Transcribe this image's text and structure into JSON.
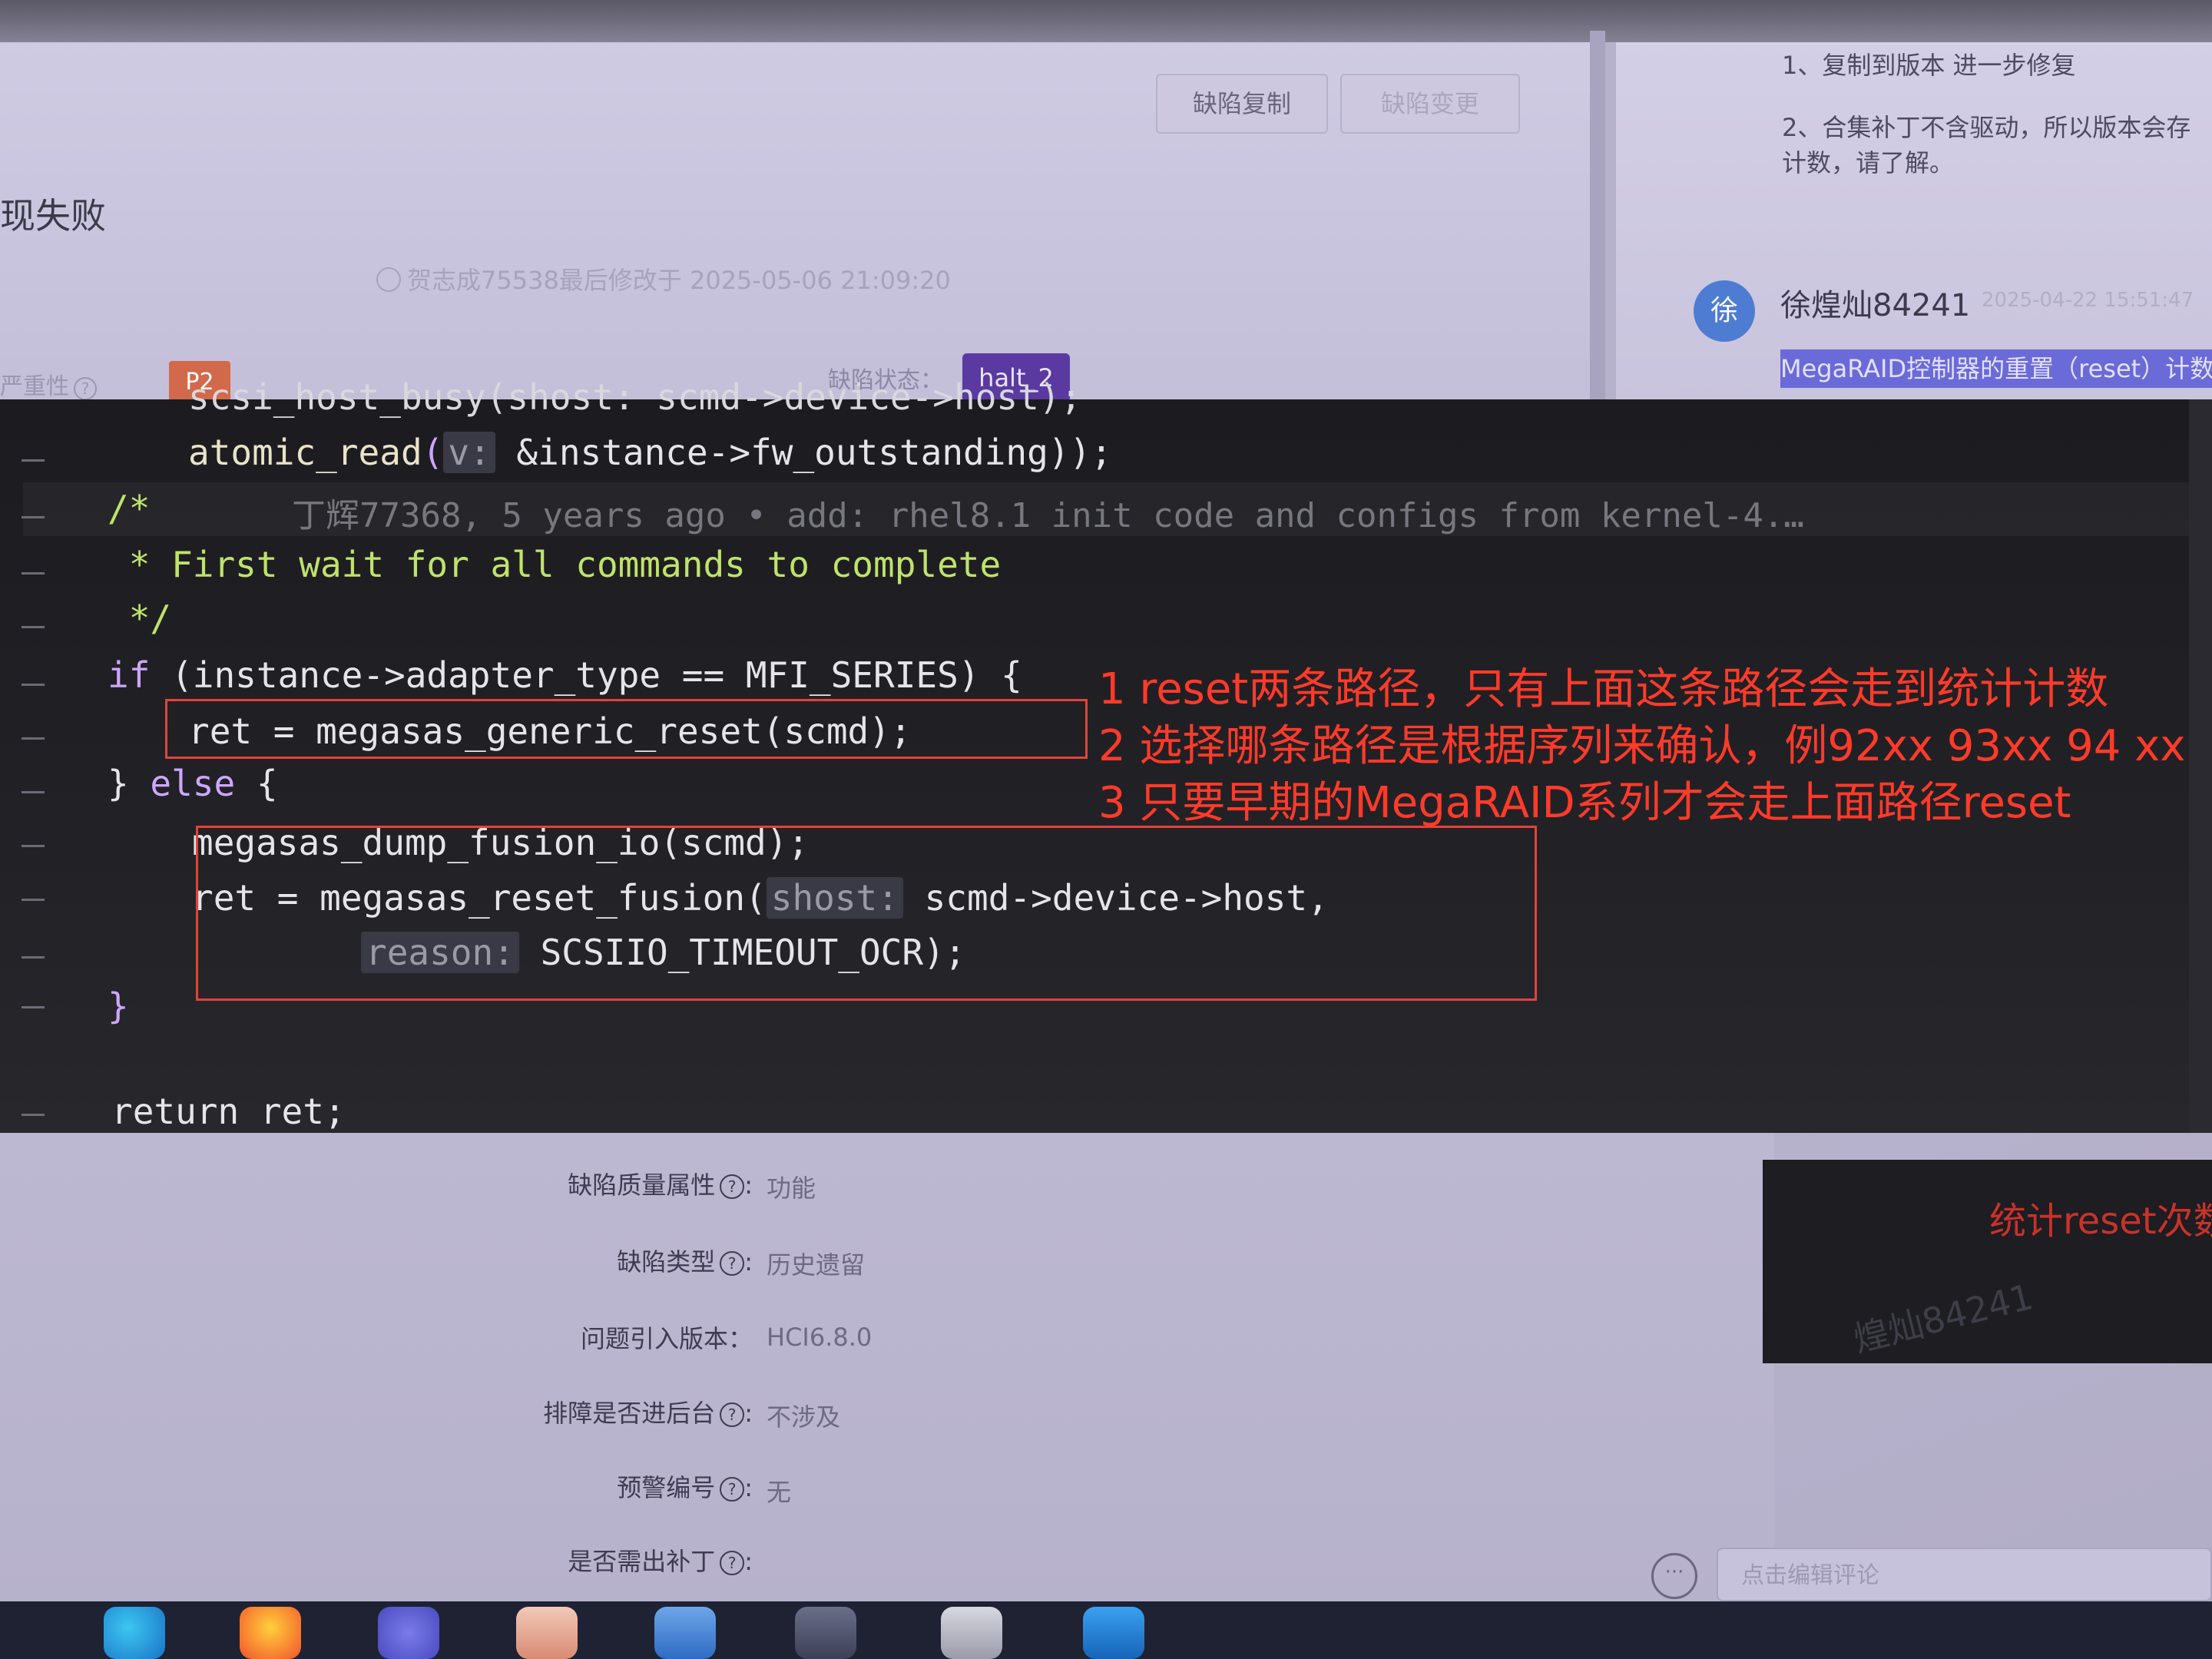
{
  "header": {
    "title_fragment": "现失败",
    "buttons": {
      "copy": "缺陷复制",
      "change": "缺陷变更"
    },
    "modified_info": "贺志成75538最后修改于 2025-05-06 21:09:20",
    "severity_label": "严重性",
    "severity_value": "P2",
    "state_label": "缺陷状态：",
    "state_value": "halt_2"
  },
  "comments": {
    "line1": "1、复制到版本 进一步修复",
    "line2": "2、合集补丁不含驱动，所以版本会存\n计数，请了解。",
    "avatar_char": "徐",
    "author": "徐煌灿84241",
    "time": "2025-04-22 15:51:47",
    "highlight": "MegaRAID控制器的重置（reset）计数"
  },
  "code": {
    "line0": "scsi_host_busy(shost: scmd->device->host);",
    "line1_fn": "atomic_read",
    "line1_hint": "v:",
    "line1_rest": " &instance->fw_outstanding));",
    "blame": "丁辉77368, 5 years ago • add: rhel8.1 init code and configs from kernel-4.…",
    "c_open": "/*",
    "c_body": " * First wait for all commands to complete",
    "c_close": " */",
    "if_kw": "if",
    "if_cond": " (instance->adapter_type == MFI_SERIES) {",
    "ret1": "ret = megasas_generic_reset(scmd);",
    "else_pre": "} ",
    "else_kw": "else",
    "else_post": " {",
    "dump": "megasas_dump_fusion_io(scmd);",
    "ret2_pre": "ret = megasas_reset_fusion(",
    "ret2_hint": "shost:",
    "ret2_rest": " scmd->device->host,",
    "reason_hint": "reason:",
    "reason_rest": " SCSIIO_TIMEOUT_OCR);",
    "close": "}",
    "return": "return ret;"
  },
  "annotations": {
    "note1": "1 reset两条路径，只有上面这条路径会走到统计计数",
    "note2": "2 选择哪条路径是根据序列来确认，例92xx 93xx 94 xx",
    "note3": "3 只要早期的MegaRAID系列才会走上面路径reset"
  },
  "details": {
    "fields": [
      {
        "label": "缺陷质量属性",
        "help": true,
        "value": "功能"
      },
      {
        "label": "缺陷类型",
        "help": true,
        "value": "历史遗留"
      },
      {
        "label": "问题引入版本：",
        "help": false,
        "value": "HCI6.8.0"
      },
      {
        "label": "排障是否进后台",
        "help": true,
        "value": "不涉及"
      },
      {
        "label": "预警编号",
        "help": true,
        "value": "无"
      },
      {
        "label": "是否需出补丁",
        "help": true,
        "value": ""
      }
    ]
  },
  "side_card": {
    "text": "统计reset次数",
    "watermark": "煌灿84241"
  },
  "comment_input": {
    "placeholder": "点击编辑评论"
  },
  "taskbar": {
    "icons": [
      "edge-icon",
      "firefox-icon",
      "power-app-icon",
      "mail-app-icon",
      "network-app-icon",
      "terminal-app-icon",
      "folder-app-icon",
      "vscode-icon"
    ]
  },
  "colors": {
    "accent": "#5a3aa0",
    "annotation_red": "#ff3a2a",
    "priority": "#d2694a",
    "avatar": "#4e7cd2"
  }
}
